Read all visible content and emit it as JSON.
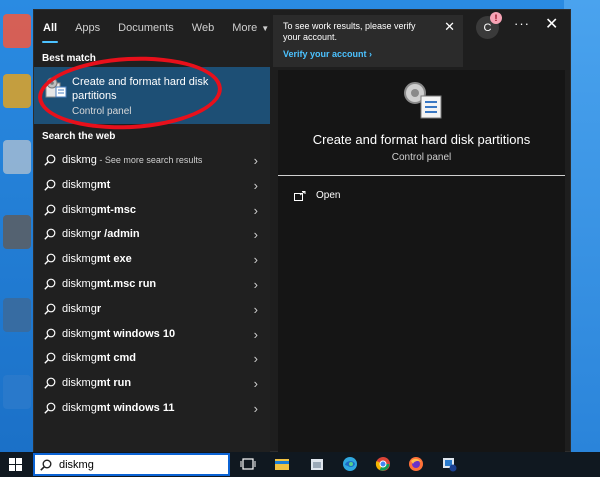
{
  "tabs": [
    "All",
    "Apps",
    "Documents",
    "Web",
    "More"
  ],
  "sections": {
    "best_match": "Best match",
    "search_web": "Search the web"
  },
  "best_match": {
    "title": "Create and format hard disk partitions",
    "subtitle": "Control panel"
  },
  "web_results": [
    {
      "bold": "diskmg",
      "rest": "",
      "more": " - See more search results"
    },
    {
      "bold": "diskmg",
      "rest": "mt",
      "more": ""
    },
    {
      "bold": "diskmg",
      "rest": "mt-msc",
      "more": ""
    },
    {
      "bold": "diskmg",
      "rest": "r /admin",
      "more": ""
    },
    {
      "bold": "diskmg",
      "rest": "mt exe",
      "more": ""
    },
    {
      "bold": "diskmg",
      "rest": "mt.msc run",
      "more": ""
    },
    {
      "bold": "diskmg",
      "rest": "r",
      "more": ""
    },
    {
      "bold": "diskmg",
      "rest": "mt windows 10",
      "more": ""
    },
    {
      "bold": "diskmg",
      "rest": "mt cmd",
      "more": ""
    },
    {
      "bold": "diskmg",
      "rest": "mt run",
      "more": ""
    },
    {
      "bold": "diskmg",
      "rest": "mt windows 11",
      "more": ""
    }
  ],
  "preview": {
    "title": "Create and format hard disk partitions",
    "subtitle": "Control panel",
    "open_label": "Open"
  },
  "toast": {
    "message": "To see work results, please verify your account.",
    "link": "Verify your account"
  },
  "account": {
    "initial": "C",
    "badge": "!"
  },
  "taskbar": {
    "search_value": "diskmg"
  },
  "colors": {
    "accent": "#4cc2ff",
    "selection": "#1d4f75",
    "highlight_ring": "#e8101b"
  }
}
